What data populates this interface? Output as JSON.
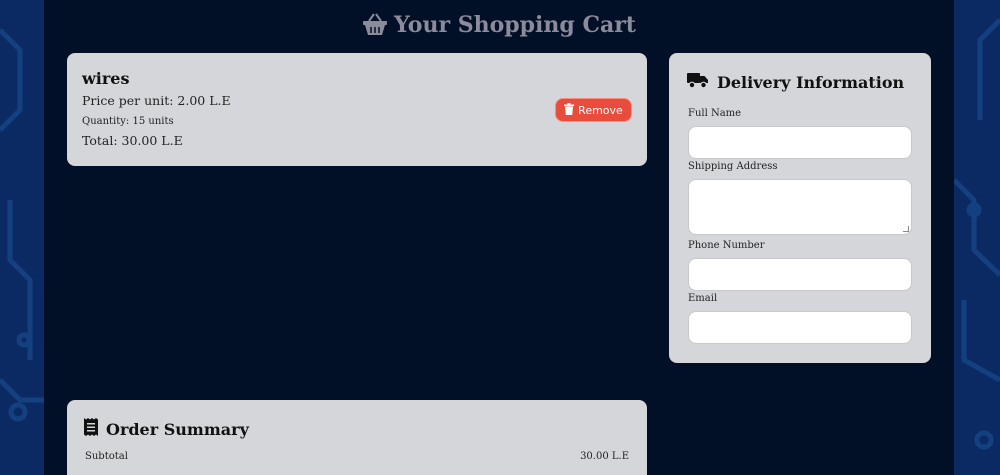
{
  "header": {
    "title": "Your Shopping Cart",
    "icon": "basket-icon"
  },
  "cart": {
    "items": [
      {
        "name": "wires",
        "price_text": "Price per unit: 2.00 L.E",
        "quantity_text": "Quantity: 15 units",
        "total_text": "Total: 30.00 L.E",
        "remove_label": "Remove",
        "remove_icon": "trash-icon"
      }
    ]
  },
  "delivery": {
    "title": "Delivery Information",
    "icon": "truck-icon",
    "fields": [
      {
        "label": "Full Name",
        "value": "",
        "type": "text"
      },
      {
        "label": "Shipping Address",
        "value": "",
        "type": "textarea"
      },
      {
        "label": "Phone Number",
        "value": "",
        "type": "text"
      },
      {
        "label": "Email",
        "value": "",
        "type": "text"
      }
    ]
  },
  "summary": {
    "title": "Order Summary",
    "icon": "receipt-icon",
    "subtotal_label": "Subtotal",
    "subtotal_value": "30.00 L.E"
  },
  "colors": {
    "page_background": "#021027",
    "card_background": "#d5d6da",
    "remove_button": "#e74c3c",
    "title_text": "#8b8b9c",
    "side_pattern": "#0b2a63"
  }
}
